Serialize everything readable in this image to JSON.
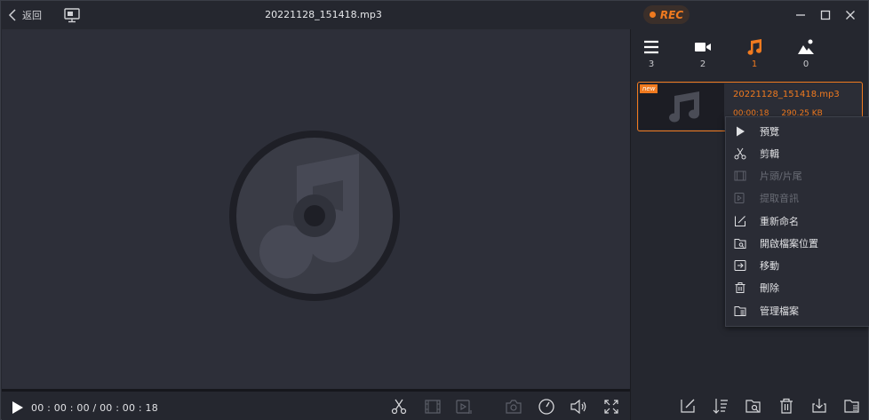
{
  "titlebar": {
    "back_label": "返回",
    "title": "20221128_151418.mp3",
    "rec_label": "REC"
  },
  "player": {
    "time_current": "00 : 00 : 00",
    "time_separator": "/",
    "time_total": "00 : 00 : 18"
  },
  "tabs": [
    {
      "icon": "list-icon",
      "count": "3"
    },
    {
      "icon": "video-icon",
      "count": "2"
    },
    {
      "icon": "music-note-icon",
      "count": "1",
      "active": true
    },
    {
      "icon": "image-icon",
      "count": "0"
    }
  ],
  "file": {
    "badge": "new",
    "name": "20221128_151418.mp3",
    "duration": "00:00:18",
    "size": "290.25 KB"
  },
  "menu": {
    "items": [
      {
        "label": "預覽",
        "icon": "play-icon",
        "enabled": true
      },
      {
        "label": "剪輯",
        "icon": "scissors-icon",
        "enabled": true
      },
      {
        "label": "片頭/片尾",
        "icon": "film-frame-icon",
        "enabled": false
      },
      {
        "label": "提取音訊",
        "icon": "extract-audio-icon",
        "enabled": false
      },
      {
        "label": "重新命名",
        "icon": "rename-icon",
        "enabled": true
      },
      {
        "label": "開啟檔案位置",
        "icon": "open-folder-icon",
        "enabled": true
      },
      {
        "label": "移動",
        "icon": "move-icon",
        "enabled": true
      },
      {
        "label": "刪除",
        "icon": "trash-icon",
        "enabled": true
      },
      {
        "label": "管理檔案",
        "icon": "manage-files-icon",
        "enabled": true
      }
    ]
  },
  "colors": {
    "accent": "#f07a1f",
    "background": "#25272f",
    "player_bg": "#2d2f39"
  }
}
